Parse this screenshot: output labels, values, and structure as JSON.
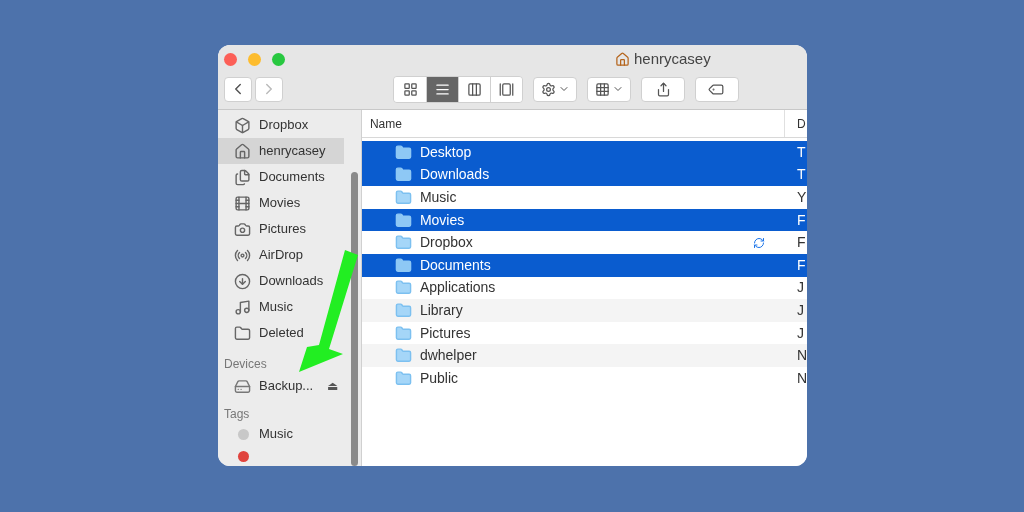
{
  "window": {
    "title": "henrycasey"
  },
  "view_buttons": [
    {
      "kind": "icons",
      "selected": false
    },
    {
      "kind": "list",
      "selected": true
    },
    {
      "kind": "columns",
      "selected": false
    },
    {
      "kind": "gallery",
      "selected": false
    }
  ],
  "sidebar": {
    "favorites": [
      {
        "label": "Dropbox",
        "kind": "dropbox",
        "selected": false
      },
      {
        "label": "henrycasey",
        "kind": "home",
        "selected": true
      },
      {
        "label": "Documents",
        "kind": "documents",
        "selected": false
      },
      {
        "label": "Movies",
        "kind": "movies",
        "selected": false
      },
      {
        "label": "Pictures",
        "kind": "pictures",
        "selected": false
      },
      {
        "label": "AirDrop",
        "kind": "airdrop",
        "selected": false
      },
      {
        "label": "Downloads",
        "kind": "downloads",
        "selected": false
      },
      {
        "label": "Music",
        "kind": "music",
        "selected": false
      },
      {
        "label": "Deleted",
        "kind": "folder",
        "selected": false
      }
    ],
    "devices_heading": "Devices",
    "devices": [
      {
        "label": "Backup...",
        "eject": "⏏"
      }
    ],
    "tags_heading": "Tags",
    "tags": [
      {
        "label": "Music",
        "color": "#c8c8c8"
      },
      {
        "color": "#e0443e"
      }
    ]
  },
  "table": {
    "columns": [
      "Name",
      "D"
    ],
    "rows": [
      {
        "name": "Desktop",
        "column_2": "T",
        "selected": true,
        "synced": false
      },
      {
        "name": "Downloads",
        "column_2": "T",
        "selected": true,
        "synced": false
      },
      {
        "name": "Music",
        "column_2": "Y",
        "selected": false,
        "synced": false
      },
      {
        "name": "Movies",
        "column_2": "F",
        "selected": true,
        "synced": false
      },
      {
        "name": "Dropbox",
        "column_2": "F",
        "selected": false,
        "synced": true
      },
      {
        "name": "Documents",
        "column_2": "F",
        "selected": true,
        "synced": false
      },
      {
        "name": "Applications",
        "column_2": "J",
        "selected": false,
        "synced": false
      },
      {
        "name": "Library",
        "column_2": "J",
        "selected": false,
        "synced": false
      },
      {
        "name": "Pictures",
        "column_2": "J",
        "selected": false,
        "synced": false
      },
      {
        "name": "dwhelper",
        "column_2": "N",
        "selected": false,
        "synced": false
      },
      {
        "name": "Public",
        "column_2": "N",
        "selected": false,
        "synced": false
      }
    ]
  }
}
